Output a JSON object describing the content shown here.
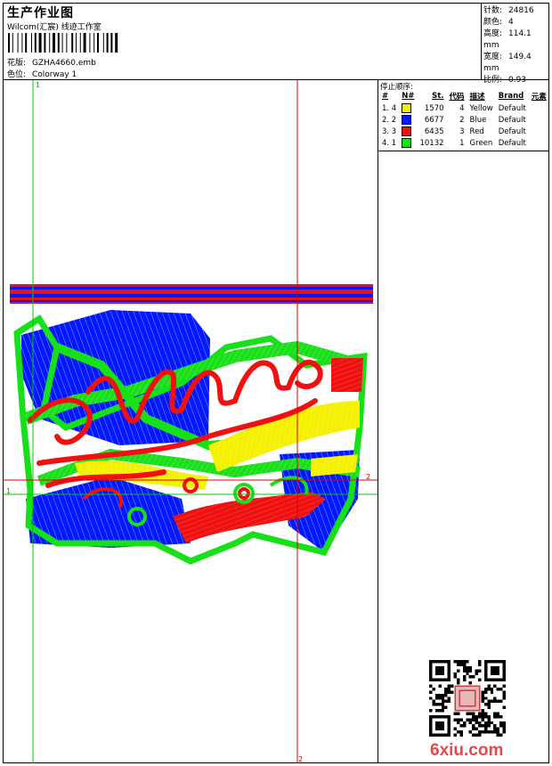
{
  "header": {
    "title": "生产作业图",
    "studio": "Wilcom(汇宸) 线迹工作室",
    "design_label": "花版:",
    "design_value": "GZHA4660.emb",
    "colorway_label": "色位:",
    "colorway_value": "Colorway 1"
  },
  "stats": [
    {
      "label": "针数:",
      "value": "24816"
    },
    {
      "label": "颜色:",
      "value": "4"
    },
    {
      "label": "高度:",
      "value": "114.1 mm"
    },
    {
      "label": "宽度:",
      "value": "149.4 mm"
    },
    {
      "label": "比例:",
      "value": "0.93"
    }
  ],
  "stop_sequence": {
    "title": "停止顺序:",
    "columns": [
      "#",
      "N#",
      "St.",
      "代码",
      "描述",
      "Brand",
      "元素"
    ],
    "rows": [
      {
        "idx": "1. 4",
        "swatch": "#f5f000",
        "st": "1570",
        "code": "4",
        "desc": "Yellow",
        "brand": "Default"
      },
      {
        "idx": "2. 2",
        "swatch": "#0018ff",
        "st": "6677",
        "code": "2",
        "desc": "Blue",
        "brand": "Default"
      },
      {
        "idx": "3. 3",
        "swatch": "#f01010",
        "st": "6435",
        "code": "3",
        "desc": "Red",
        "brand": "Default"
      },
      {
        "idx": "4. 1",
        "swatch": "#18e018",
        "st": "10132",
        "code": "1",
        "desc": "Green",
        "brand": "Default"
      }
    ]
  },
  "guides": {
    "v1": "1",
    "h1": "1",
    "h2": "2",
    "v2": "2"
  },
  "colors": {
    "yellow": "#f5f000",
    "blue": "#0018ff",
    "red": "#f01010",
    "green": "#18e018",
    "guide_green": "#00c800",
    "guide_red": "#e00000"
  },
  "watermark": "6xiu.com"
}
